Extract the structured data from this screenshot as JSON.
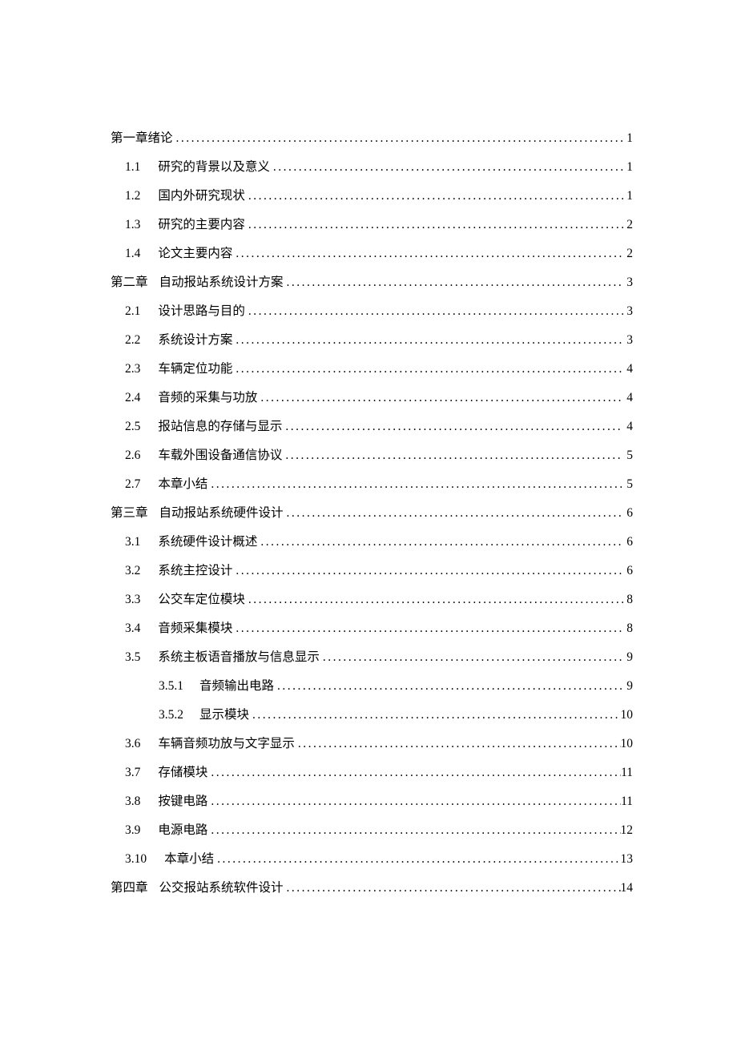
{
  "toc": [
    {
      "level": 0,
      "num": "第一章",
      "title": "绪论",
      "page": "1",
      "numClass": "ch",
      "inline": true
    },
    {
      "level": 1,
      "num": "1.1",
      "title": "研究的背景以及意义",
      "page": "1",
      "numClass": "sec"
    },
    {
      "level": 1,
      "num": "1.2",
      "title": "国内外研究现状",
      "page": "1",
      "numClass": "sec"
    },
    {
      "level": 1,
      "num": "1.3",
      "title": "研究的主要内容",
      "page": "2",
      "numClass": "sec"
    },
    {
      "level": 1,
      "num": "1.4",
      "title": "论文主要内容",
      "page": "2",
      "numClass": "sec"
    },
    {
      "level": 0,
      "num": "第二章",
      "title": "自动报站系统设计方案",
      "page": "3",
      "numClass": "ch"
    },
    {
      "level": 1,
      "num": "2.1",
      "title": "设计思路与目的",
      "page": "3",
      "numClass": "sec"
    },
    {
      "level": 1,
      "num": "2.2",
      "title": "系统设计方案",
      "page": "3",
      "numClass": "sec"
    },
    {
      "level": 1,
      "num": "2.3",
      "title": "车辆定位功能",
      "page": "4",
      "numClass": "sec"
    },
    {
      "level": 1,
      "num": "2.4",
      "title": "音频的采集与功放",
      "page": "4",
      "numClass": "sec"
    },
    {
      "level": 1,
      "num": "2.5",
      "title": "报站信息的存储与显示",
      "page": "4",
      "numClass": "sec"
    },
    {
      "level": 1,
      "num": "2.6",
      "title": "车载外围设备通信协议",
      "page": "5",
      "numClass": "sec"
    },
    {
      "level": 1,
      "num": "2.7",
      "title": "本章小结",
      "page": "5",
      "numClass": "sec"
    },
    {
      "level": 0,
      "num": "第三章",
      "title": "自动报站系统硬件设计",
      "page": "6",
      "numClass": "ch"
    },
    {
      "level": 1,
      "num": "3.1",
      "title": "系统硬件设计概述",
      "page": "6",
      "numClass": "sec"
    },
    {
      "level": 1,
      "num": "3.2",
      "title": "系统主控设计",
      "page": "6",
      "numClass": "sec"
    },
    {
      "level": 1,
      "num": "3.3",
      "title": "公交车定位模块",
      "page": "8",
      "numClass": "sec"
    },
    {
      "level": 1,
      "num": "3.4",
      "title": "音频采集模块",
      "page": "8",
      "numClass": "sec"
    },
    {
      "level": 1,
      "num": "3.5",
      "title": "系统主板语音播放与信息显示",
      "page": "9",
      "numClass": "sec"
    },
    {
      "level": 2,
      "num": "3.5.1",
      "title": "音频输出电路",
      "page": "9",
      "numClass": "sub"
    },
    {
      "level": 2,
      "num": "3.5.2",
      "title": "显示模块",
      "page": "10",
      "numClass": "sub"
    },
    {
      "level": 1,
      "num": "3.6",
      "title": "车辆音频功放与文字显示",
      "page": "10",
      "numClass": "sec"
    },
    {
      "level": 1,
      "num": "3.7",
      "title": "存储模块",
      "page": "11",
      "numClass": "sec"
    },
    {
      "level": 1,
      "num": "3.8",
      "title": "按键电路",
      "page": "11",
      "numClass": "sec"
    },
    {
      "level": 1,
      "num": "3.9",
      "title": "电源电路",
      "page": "12",
      "numClass": "sec"
    },
    {
      "level": 1,
      "num": "3.10",
      "title": "本章小结",
      "page": "13",
      "numClass": "sec"
    },
    {
      "level": 0,
      "num": "第四章",
      "title": "公交报站系统软件设计",
      "page": "14",
      "numClass": "ch"
    }
  ]
}
